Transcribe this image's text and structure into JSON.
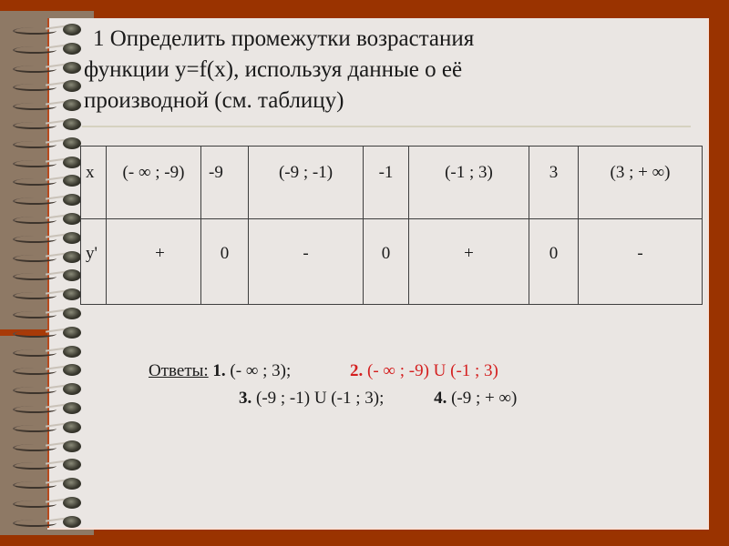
{
  "slide": {
    "title_lines": [
      "1 Определить промежутки возрастания",
      "функции y=f(x), используя данные о её",
      "производной  (см. таблицу)"
    ]
  },
  "table": {
    "row_x": {
      "label": "x",
      "cells": [
        "(- ∞ ; -9)",
        "-9",
        "(-9 ; -1)",
        "-1",
        "(-1 ; 3)",
        "3",
        "(3 ; + ∞)"
      ]
    },
    "row_y": {
      "label": "y'",
      "cells": [
        "+",
        "0",
        "-",
        "0",
        "+",
        "0",
        "-"
      ]
    }
  },
  "answers": {
    "heading": "Ответы:",
    "options": [
      {
        "num": "1.",
        "text": " (- ∞ ; 3);"
      },
      {
        "num": "2.",
        "text": " (- ∞ ; -9) U (-1 ; 3)"
      },
      {
        "num": "3.",
        "text": " (-9 ; -1) U (-1 ; 3);"
      },
      {
        "num": "4.",
        "text": " (-9 ; + ∞)"
      }
    ],
    "highlight_color": "#D42020"
  },
  "colors": {
    "background": "#9A3300",
    "paper": "#EAE6E3",
    "cover": "#8E7965"
  }
}
